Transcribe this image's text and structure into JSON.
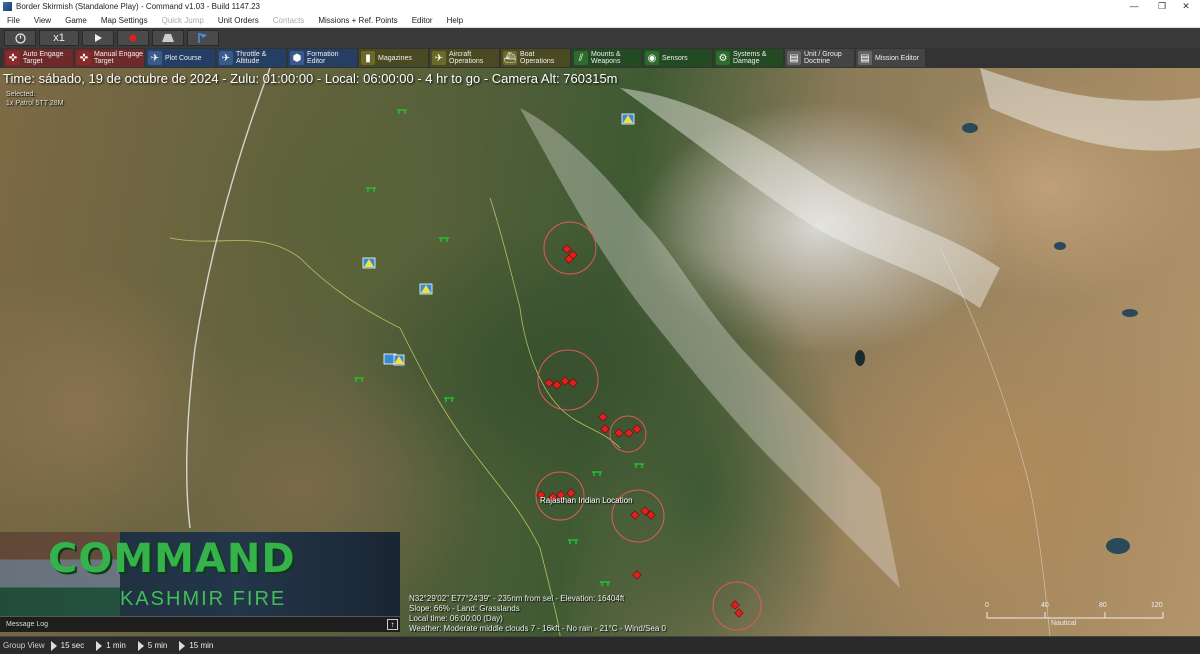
{
  "window": {
    "title": "Border Skirmish (Standalone Play) - Command v1.03 - Build 1147.23",
    "controls": [
      "—",
      "❐",
      "✕"
    ]
  },
  "menu": [
    "File",
    "View",
    "Game",
    "Map Settings",
    "Quick Jump",
    "Unit Orders",
    "Contacts",
    "Missions + Ref. Points",
    "Editor",
    "Help"
  ],
  "time_controls": {
    "clock_icon": "clock-icon",
    "speed": "x1",
    "play_icon": "play-icon",
    "record_icon": "record-icon",
    "road_icon": "road-icon",
    "flag_icon": "flag-icon"
  },
  "command_toolbar": [
    {
      "label": "Auto Engage Target",
      "icon": "crosshair-icon",
      "color": "#8a2a2a"
    },
    {
      "label": "Manual Engage Target",
      "icon": "crosshair-icon",
      "color": "#8a2a2a"
    },
    {
      "label": "Plot Course",
      "icon": "course-icon",
      "color": "#2a4a7a"
    },
    {
      "label": "Throttle & Altitude",
      "icon": "throttle-icon",
      "color": "#2a4a7a"
    },
    {
      "label": "Formation Editor",
      "icon": "formation-icon",
      "color": "#2a4a7a"
    },
    {
      "label": "Magazines",
      "icon": "ammo-icon",
      "color": "#5a5a2a"
    },
    {
      "label": "Aircraft Operations",
      "icon": "aircraft-icon",
      "color": "#5a5a2a"
    },
    {
      "label": "Boat Operations",
      "icon": "boat-icon",
      "color": "#5a5a2a"
    },
    {
      "label": "Mounts & Weapons",
      "icon": "weapons-icon",
      "color": "#2a5a2a"
    },
    {
      "label": "Sensors",
      "icon": "sensor-icon",
      "color": "#2a5a2a"
    },
    {
      "label": "Systems & Damage",
      "icon": "gear-icon",
      "color": "#2a5a2a"
    },
    {
      "label": "Unit / Group Doctrine",
      "icon": "doctrine-icon",
      "color": "#555555"
    },
    {
      "label": "Mission Editor",
      "icon": "mission-icon",
      "color": "#555555"
    }
  ],
  "map": {
    "status": "Time: sábado, 19 de octubre de 2024 - Zulu: 01:00:00 - Local: 06:00:00 - 4 hr to go -  Camera Alt: 760315m",
    "selected_label": "Selected:",
    "selected_sub": "1x Patrol 5TT 28M",
    "location_label": "Rajasthan Indian Location",
    "coords": [
      "N32°29'02\" E77°24'39\" - 235nm from sel - Elevation: 16404ft",
      "Slope: 66% - Land: Grasslands",
      "Local time: 06:00:00 (Day)",
      "Weather: Moderate middle clouds 7 - 16kft - No rain - 21°C - Wind/Sea 0"
    ],
    "scale_labels": [
      "0",
      "40",
      "80",
      "120"
    ],
    "scale_unit": "Nautical"
  },
  "banner": {
    "title": "COMMAND",
    "subtitle": "KASHMIR FIRE"
  },
  "message_log": {
    "label": "Message Log",
    "expand": "↑"
  },
  "bottom_bar": {
    "group_view": "Group View",
    "steps": [
      "15 sec",
      "1 min",
      "5 min",
      "15 min"
    ]
  },
  "colors": {
    "hostile": "#e02020",
    "friendly": "#20c030",
    "range_ring": "#e05a5a"
  }
}
